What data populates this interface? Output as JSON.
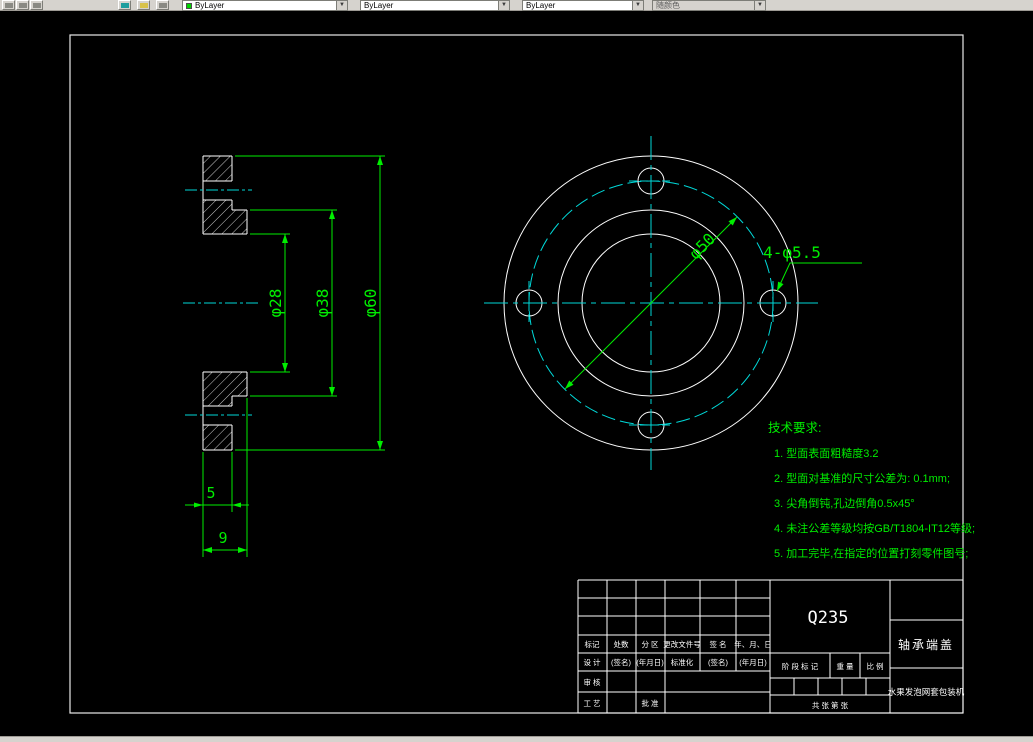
{
  "toolbar": {
    "color_combo_value": "ByLayer",
    "linetype_combo_value": "ByLayer",
    "lineweight_combo_value": "ByLayer",
    "plotstyle_combo_value": "随颜色",
    "dropdown_arrow": "▼",
    "swatch_color": "#00d400"
  },
  "colors": {
    "background": "#000000",
    "outline": "#ffffff",
    "dimension": "#00ee00",
    "centerline": "#00d9d9"
  },
  "section_view": {
    "dim_bore": "φ28",
    "dim_boss": "φ38",
    "dim_outer": "φ60",
    "dim_flange_thickness": "5",
    "dim_total_length": "9"
  },
  "front_view": {
    "dim_bolt_circle": "φ50",
    "dim_bolt_holes": "4-φ5.5"
  },
  "tech_requirements": {
    "title": "技术要求:",
    "items": [
      "1. 型面表面粗糙度3.2",
      "2. 型面对基准的尺寸公差为: 0.1mm;",
      "3. 尖角倒钝,孔边倒角0.5x45°",
      "4. 未注公差等级均按GB/T1804-IT12等级;",
      "5. 加工完毕,在指定的位置打刻零件图号;"
    ]
  },
  "title_block": {
    "material": "Q235",
    "part_name": "轴承端盖",
    "machine_name": "水果发泡网套包装机",
    "header_row": [
      "标记",
      "处数",
      "分 区",
      "更改文件号",
      "签 名",
      "年、月、日"
    ],
    "design_row": [
      "设 计",
      "(签名)",
      "(年月日)",
      "标准化",
      "(签名)",
      "(年月日)"
    ],
    "row_check": "审 核",
    "row_process": "工 艺",
    "row_approve": "批 准",
    "stage_label": "阶 段 标 记",
    "weight_label": "重 量",
    "scale_label": "比 例",
    "sheet_label": "共  张  第  张"
  }
}
